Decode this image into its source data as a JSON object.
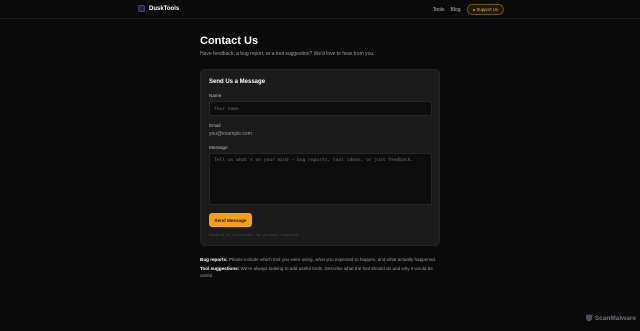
{
  "header": {
    "brand": "DuskTools",
    "nav": {
      "tools": "Tools",
      "blog": "Blog",
      "support": "Support Us"
    }
  },
  "page": {
    "title": "Contact Us",
    "subtitle": "Have feedback, a bug report, or a tool suggestion? We'd love to hear from you."
  },
  "form": {
    "title": "Send Us a Message",
    "name_label": "Name",
    "name_placeholder": "Your name",
    "email_label": "Email",
    "email_value": "you@example.com",
    "message_label": "Message",
    "message_placeholder": "Tell us what's on your mind — bug reports, tool ideas, or just feedback.",
    "submit": "Send Message",
    "powered_by": "Powered by Formspree. No account required."
  },
  "notes": {
    "bug_title": "Bug reports:",
    "bug_text": "Please include which tool you were using, what you expected to happen, and what actually happened.",
    "suggest_title": "Tool suggestions:",
    "suggest_text": "We're always looking to add useful tools. Describe what the tool should do and why it would be useful."
  },
  "watermark": {
    "text": "ScanMalware"
  },
  "colors": {
    "background": "#0a0a0a",
    "card": "#1b1b1b",
    "accent": "#f5a00e"
  }
}
